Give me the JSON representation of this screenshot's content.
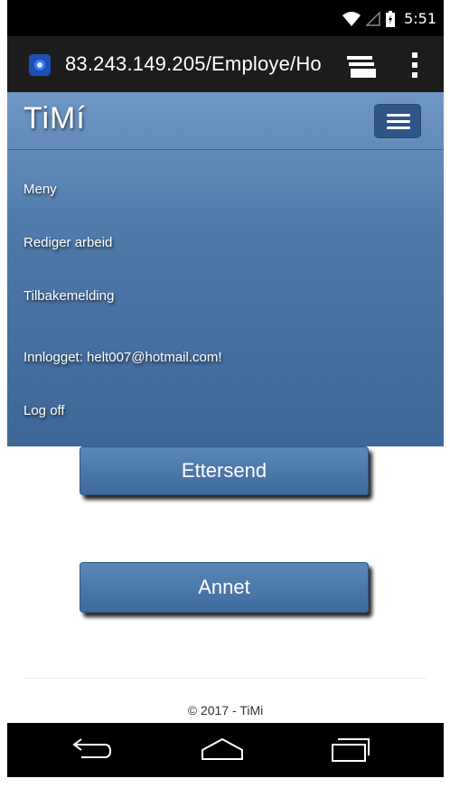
{
  "status_bar": {
    "time": "5:51"
  },
  "browser": {
    "url": "83.243.149.205/Employe/Ho"
  },
  "header": {
    "brand": "TiMí",
    "menu": [
      "Meny",
      "Rediger arbeid",
      "Tilbakemelding"
    ],
    "logged_in": "Innlogget: helt007@hotmail.com!",
    "logoff": "Log off"
  },
  "main": {
    "buttons": [
      "Ettersend",
      "Annet"
    ]
  },
  "footer": {
    "copyright": "© 2017 - TiMi"
  },
  "icons": {
    "status": [
      "wifi-icon",
      "signal-icon",
      "battery-icon"
    ],
    "browser": [
      "site-favicon-icon",
      "tabs-icon",
      "overflow-menu-icon"
    ],
    "system": [
      "back-icon",
      "home-icon",
      "recents-icon"
    ]
  },
  "colors": {
    "navbar_top": "#6f97c4",
    "navbar_bottom": "#3d6797",
    "button": "#4a77a9"
  }
}
